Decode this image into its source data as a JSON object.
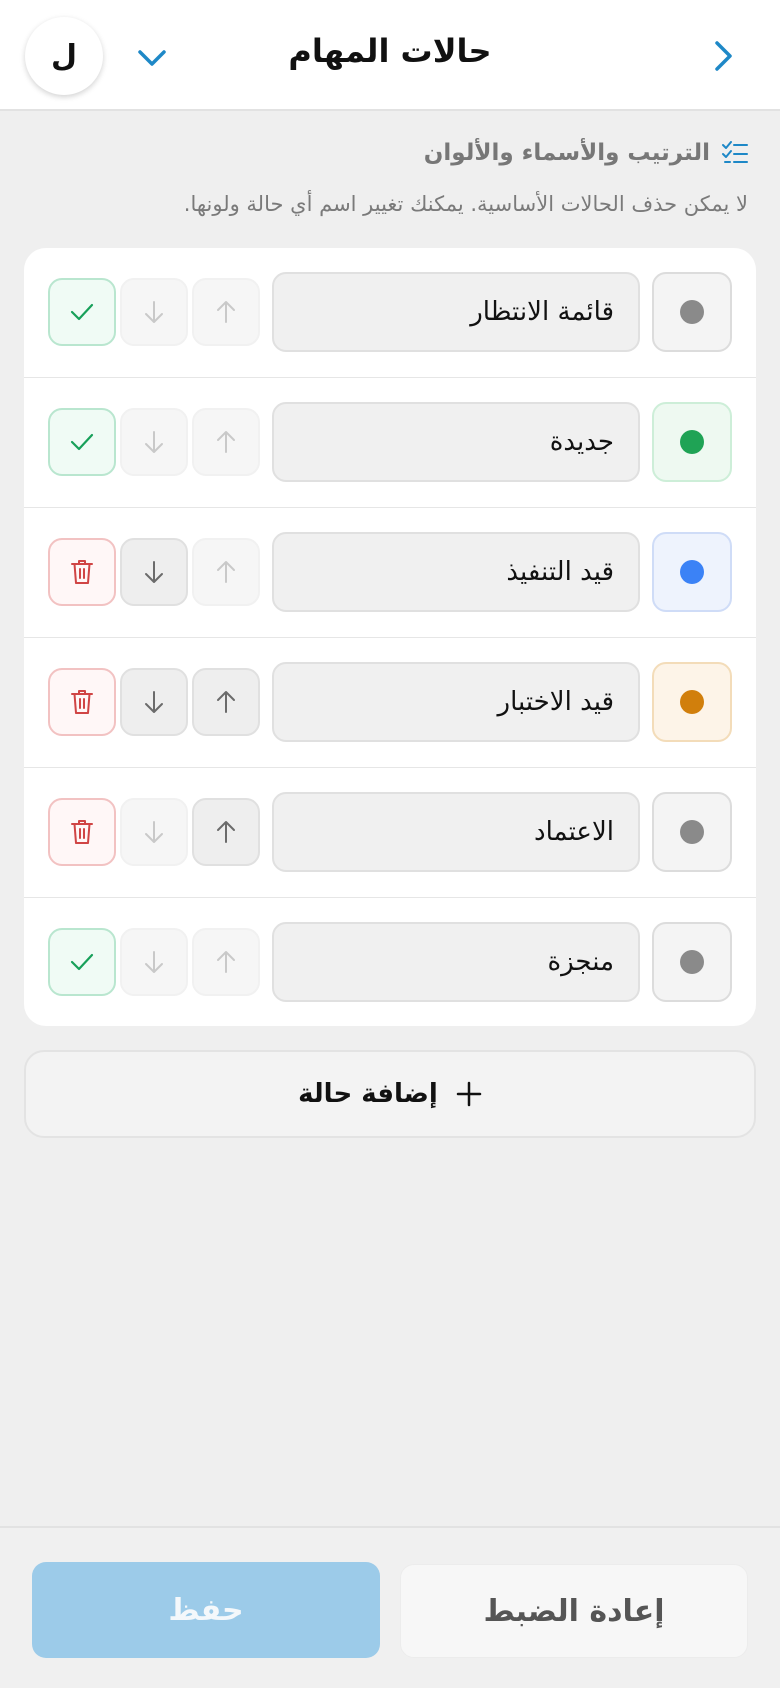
{
  "header": {
    "title": "حالات المهام",
    "avatar_letter": "ل",
    "back_icon": "chevron-right-icon",
    "dropdown_icon": "chevron-down-icon"
  },
  "section": {
    "title": "الترتيب والأسماء والألوان",
    "description": "لا يمكن حذف الحالات الأساسية. يمكنك تغيير اسم أي حالة ولونها.",
    "icon": "checklist-icon"
  },
  "statuses": [
    {
      "name": "قائمة الانتظار",
      "color": "#8a8a8a",
      "swatch_bg": "#f4f4f4",
      "swatch_border": "#dcdcdc",
      "can_move_up": false,
      "can_move_down": false,
      "action": "check"
    },
    {
      "name": "جديدة",
      "color": "#1fa355",
      "swatch_bg": "#eef9f1",
      "swatch_border": "#cdeed8",
      "can_move_up": false,
      "can_move_down": false,
      "action": "check"
    },
    {
      "name": "قيد التنفيذ",
      "color": "#3b82f6",
      "swatch_bg": "#eef3fd",
      "swatch_border": "#cfdcf7",
      "can_move_up": false,
      "can_move_down": true,
      "action": "delete"
    },
    {
      "name": "قيد الاختبار",
      "color": "#d17f0c",
      "swatch_bg": "#fdf4e8",
      "swatch_border": "#f3dcb9",
      "can_move_up": true,
      "can_move_down": true,
      "action": "delete"
    },
    {
      "name": "الاعتماد",
      "color": "#8a8a8a",
      "swatch_bg": "#f4f4f4",
      "swatch_border": "#dcdcdc",
      "can_move_up": true,
      "can_move_down": false,
      "action": "delete"
    },
    {
      "name": "منجزة",
      "color": "#8a8a8a",
      "swatch_bg": "#f4f4f4",
      "swatch_border": "#dcdcdc",
      "can_move_up": false,
      "can_move_down": false,
      "action": "check"
    }
  ],
  "add_button": {
    "label": "إضافة حالة",
    "icon": "plus-icon"
  },
  "footer": {
    "reset_label": "إعادة الضبط",
    "save_label": "حفظ"
  },
  "colors": {
    "accent": "#1e88c7",
    "save_disabled": "#9ccbe9",
    "check_green": "#18a05a",
    "trash_red": "#d04545"
  }
}
